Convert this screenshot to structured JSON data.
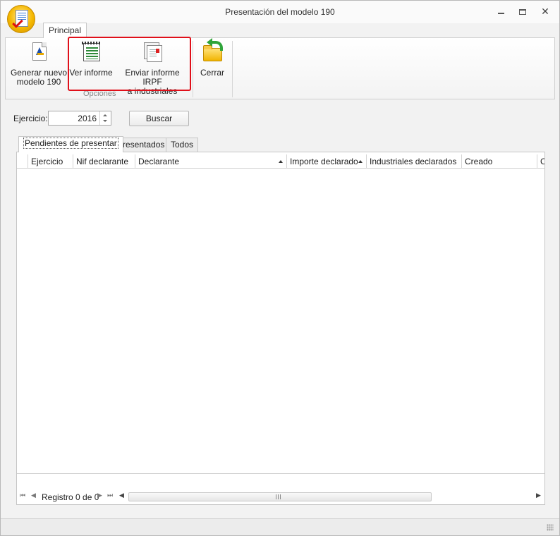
{
  "window": {
    "title": "Presentación del modelo 190"
  },
  "ribbon": {
    "tab": "Principal",
    "group_label": "Opciones",
    "buttons": {
      "new": "Generar nuevo\nmodelo 190",
      "view": "Ver informe",
      "send": "Enviar informe IRPF\na industriales",
      "close": "Cerrar"
    }
  },
  "filter": {
    "label": "Ejercicio:",
    "year": "2016",
    "search_label": "Buscar"
  },
  "tabs": [
    "Pendientes de presentar",
    "Presentados",
    "Todos"
  ],
  "columns": [
    "Ejercicio",
    "Nif declarante",
    "Declarante",
    "Importe declarado",
    "Industriales declarados",
    "Creado",
    "C"
  ],
  "rows": [],
  "navigator": {
    "record_text": "Registro 0 de 0"
  },
  "colors": {
    "highlight": "#e0101a",
    "accent": "#2fa43a"
  }
}
